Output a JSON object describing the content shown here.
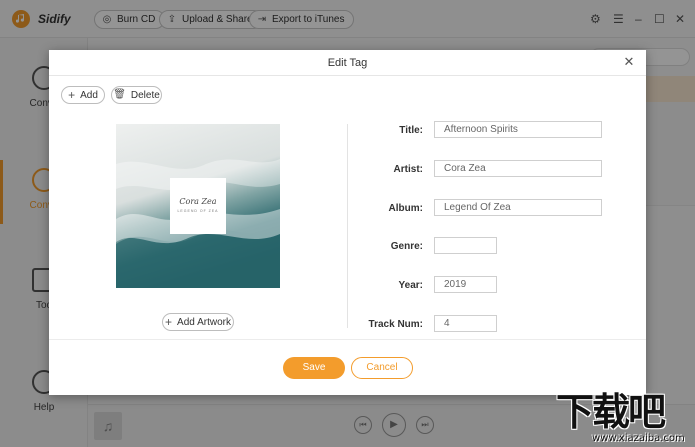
{
  "app": {
    "name": "Sidify",
    "toolbar": {
      "burn_cd": "Burn CD",
      "upload_share": "Upload & Share",
      "export_itunes": "Export to iTunes"
    },
    "window_controls": {
      "settings": "⚙",
      "menu": "☰",
      "minimize": "–",
      "maximize": "☐",
      "close": "✕"
    },
    "sidebar": {
      "items": [
        {
          "label": "Conve",
          "icon": "convert-icon"
        },
        {
          "label": "Conve",
          "icon": "converted-clock-icon",
          "active": true
        },
        {
          "label": "Too",
          "icon": "toolbox-icon"
        },
        {
          "label": "Help",
          "icon": "help-icon"
        }
      ]
    },
    "player": {
      "music_icon": "♫",
      "prev": "⏮",
      "play": "▶",
      "next": "⏭"
    },
    "accent_color": "#f39c2c"
  },
  "dialog": {
    "title": "Edit Tag",
    "close_icon": "✕",
    "add_label": "Add",
    "delete_label": "Delete",
    "artwork": {
      "cover_title": "Cora Zea",
      "cover_subtitle": "LEGEND OF ZEA"
    },
    "add_artwork_label": "Add Artwork",
    "fields": {
      "title": {
        "label": "Title:",
        "value": "Afternoon Spirits"
      },
      "artist": {
        "label": "Artist:",
        "value": "Cora Zea"
      },
      "album": {
        "label": "Album:",
        "value": "Legend Of Zea"
      },
      "genre": {
        "label": "Genre:",
        "value": ""
      },
      "year": {
        "label": "Year:",
        "value": "2019"
      },
      "track_num": {
        "label": "Track Num:",
        "value": "4"
      }
    },
    "save_label": "Save",
    "cancel_label": "Cancel"
  },
  "watermark": {
    "big": "下载吧",
    "small": "www.xiazaiba.com"
  }
}
